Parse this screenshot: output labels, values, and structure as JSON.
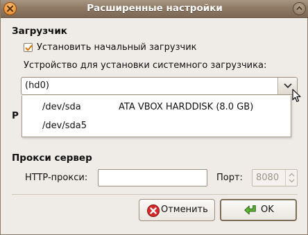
{
  "window": {
    "title": "Расширенные настройки"
  },
  "bootloader": {
    "section_label": "Загрузчик",
    "install_checkbox_label": "Установить начальный загрузчик",
    "install_checked": true,
    "device_label": "Устройство для установки системного загрузчика:",
    "selected_device": "(hd0)",
    "dropdown_items": [
      {
        "device": "/dev/sda",
        "description": "ATA VBOX HARDDISK (8.0 GB)"
      },
      {
        "device": "/dev/sda5",
        "description": ""
      }
    ],
    "obscured_section_fragment": "Р"
  },
  "proxy": {
    "section_label": "Прокси сервер",
    "http_label": "HTTP-прокси:",
    "http_value": "",
    "port_label": "Порт:",
    "port_value": "8080"
  },
  "buttons": {
    "cancel_label": "Отменить",
    "ok_label": "OK"
  },
  "icons": {
    "cancel": "cancel-icon",
    "ok": "ok-arrow-icon",
    "combo_arrow": "chevron-down-icon"
  },
  "colors": {
    "titlebar": "#8F7B66",
    "checkbox_mark": "#E07A10",
    "cancel_icon": "#D42A2A",
    "ok_icon": "#4EA22F"
  }
}
